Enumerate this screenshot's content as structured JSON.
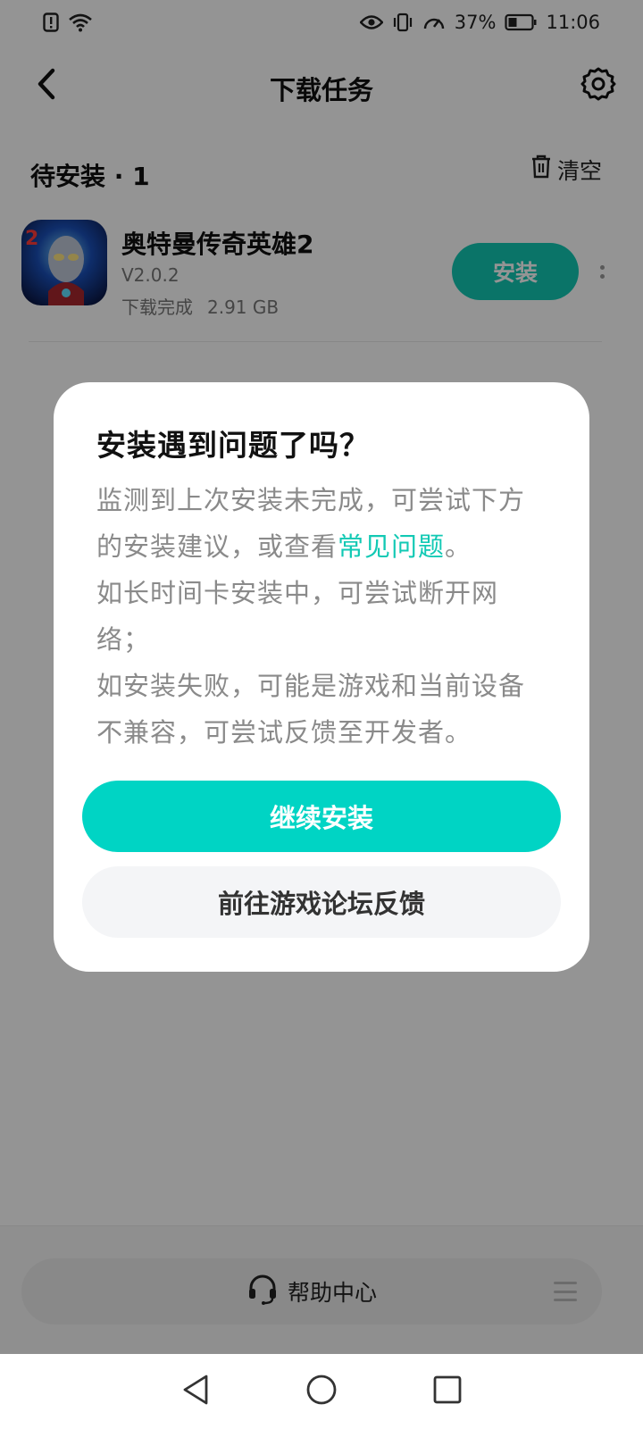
{
  "status_bar": {
    "battery_percent": "37%",
    "time": "11:06",
    "icons": [
      "sim-alert-icon",
      "wifi-icon",
      "eye-icon",
      "vibrate-icon",
      "speed-icon",
      "battery-icon"
    ]
  },
  "header": {
    "title": "下载任务",
    "back_icon": "chevron-left-icon",
    "settings_icon": "gear-icon"
  },
  "section": {
    "title": "待安装 · 1",
    "clear_label": "清空",
    "clear_icon": "trash-icon"
  },
  "app": {
    "name": "奥特曼传奇英雄2",
    "version": "V2.0.2",
    "status": "下载完成",
    "size": "2.91 GB",
    "install_label": "安装",
    "more_icon": "more-vertical-icon"
  },
  "dialog": {
    "title": "安装遇到问题了吗？",
    "body_part1": "监测到上次安装未完成，可尝试下方的安装建议，或查看",
    "body_link": "常见问题",
    "body_part2": "。",
    "body_line2": "如长时间卡安装中，可尝试断开网络；",
    "body_line3": "如安装失败，可能是游戏和当前设备不兼容，可尝试反馈至开发者。",
    "primary_label": "继续安装",
    "secondary_label": "前往游戏论坛反馈"
  },
  "help": {
    "label": "帮助中心",
    "icon": "headset-icon",
    "menu_icon": "menu-icon"
  },
  "nav": {
    "icons": [
      "back-triangle-icon",
      "home-circle-icon",
      "recents-square-icon"
    ]
  },
  "colors": {
    "accent": "#12c9b4",
    "primary_button": "#00d4c4",
    "overlay": "rgba(0,0,0,0.42)"
  }
}
